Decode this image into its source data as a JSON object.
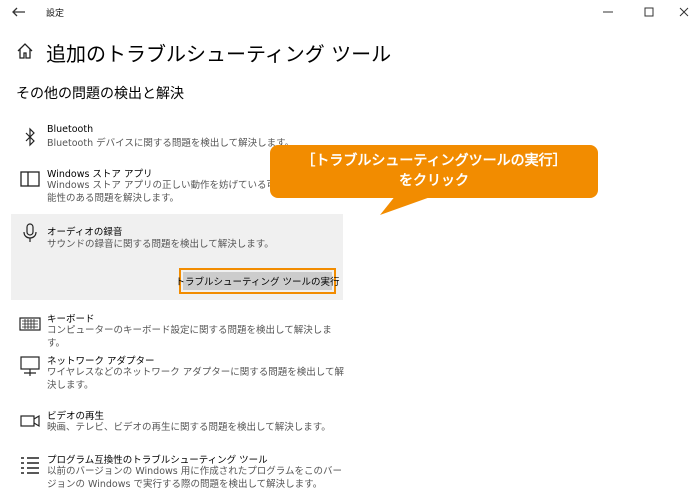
{
  "window": {
    "title": "設定"
  },
  "page": {
    "title": "追加のトラブルシューティング ツール",
    "section": "その他の問題の検出と解決"
  },
  "items": [
    {
      "title": "Bluetooth",
      "desc": "Bluetooth デバイスに関する問題を検出して解決します。",
      "icon": "bluetooth-icon"
    },
    {
      "title": "Windows ストア アプリ",
      "desc": "Windows ストア アプリの正しい動作を妨げている可能性のある問題を解決します。",
      "icon": "store-app-icon"
    },
    {
      "title": "オーディオの録音",
      "desc": "サウンドの録音に関する問題を検出して解決します。",
      "icon": "microphone-icon"
    },
    {
      "title": "キーボード",
      "desc": "コンピューターのキーボード設定に関する問題を検出して解決します。",
      "icon": "keyboard-icon"
    },
    {
      "title": "ネットワーク アダプター",
      "desc": "ワイヤレスなどのネットワーク アダプターに関する問題を検出して解決します。",
      "icon": "network-adapter-icon"
    },
    {
      "title": "ビデオの再生",
      "desc": "映画、テレビ、ビデオの再生に関する問題を検出して解決します。",
      "icon": "video-icon"
    },
    {
      "title": "プログラム互換性のトラブルシューティング ツール",
      "desc": "以前のバージョンの Windows 用に作成されたプログラムをこのバージョンの Windows で実行する際の問題を検出して解決します。",
      "icon": "program-compat-icon"
    }
  ],
  "run_button": {
    "label": "トラブルシューティング ツールの実行"
  },
  "callout": {
    "line1": "［トラブルシューティングツールの実行］",
    "line2": "をクリック",
    "color": "#f28c00"
  }
}
